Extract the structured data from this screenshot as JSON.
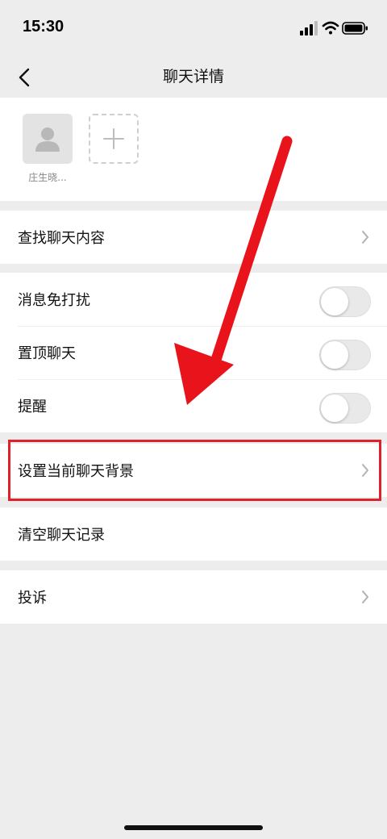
{
  "status_bar": {
    "time": "15:30"
  },
  "nav": {
    "title": "聊天详情",
    "back_icon": "chevron-left-icon"
  },
  "members": [
    {
      "name": "庄生晓...",
      "avatar_icon": "person-placeholder-icon"
    }
  ],
  "add_member_icon": "plus-icon",
  "groups": [
    {
      "rows": [
        {
          "label": "查找聊天内容",
          "control": "chevron"
        }
      ]
    },
    {
      "rows": [
        {
          "label": "消息免打扰",
          "control": "toggle",
          "on": false
        },
        {
          "label": "置顶聊天",
          "control": "toggle",
          "on": false
        },
        {
          "label": "提醒",
          "control": "toggle",
          "on": false
        }
      ]
    },
    {
      "rows": [
        {
          "label": "设置当前聊天背景",
          "control": "chevron",
          "highlighted": true
        }
      ]
    },
    {
      "rows": [
        {
          "label": "清空聊天记录",
          "control": "none"
        }
      ]
    },
    {
      "rows": [
        {
          "label": "投诉",
          "control": "chevron"
        }
      ]
    }
  ],
  "colors": {
    "background": "#ededed",
    "card": "#ffffff",
    "highlight": "#e0202a",
    "toggle_off": "#e9e9e9"
  }
}
